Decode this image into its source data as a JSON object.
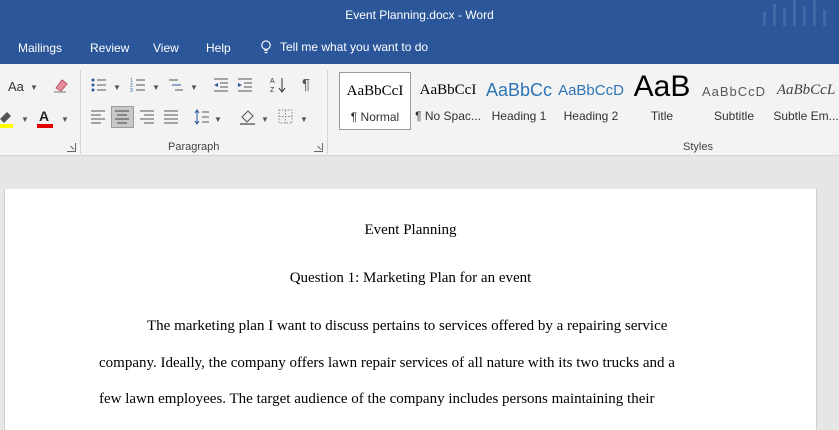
{
  "window": {
    "title": "Event Planning.docx  -  Word"
  },
  "menu": {
    "tabs": [
      "Mailings",
      "Review",
      "View",
      "Help"
    ],
    "tell_me": "Tell me what you want to do"
  },
  "ribbon": {
    "font_group": {
      "change_case_label": "Aa",
      "font_color_letter": "A",
      "highlight_color": "#ffff00",
      "font_color": "#e00000"
    },
    "paragraph_group": {
      "label": "Paragraph",
      "show_marks_glyph": "¶"
    },
    "styles_group": {
      "label": "Styles",
      "items": [
        {
          "sample": "AaBbCcI",
          "name": "¶ Normal",
          "selected": true
        },
        {
          "sample": "AaBbCcI",
          "name": "¶ No Spac..."
        },
        {
          "sample": "AaBbCc",
          "name": "Heading 1",
          "color": "#2e74b5"
        },
        {
          "sample": "AaBbCcD",
          "name": "Heading 2",
          "color": "#2e74b5"
        },
        {
          "sample": "AaB",
          "name": "Title"
        },
        {
          "sample": "AaBbCcD",
          "name": "Subtitle",
          "color": "#595959"
        },
        {
          "sample": "AaBbCcL",
          "name": "Subtle Em...",
          "color": "#404040"
        }
      ]
    }
  },
  "document": {
    "lines": [
      "Event Planning",
      "Question 1: Marketing Plan for an event",
      "The marketing plan I want to discuss pertains to services offered by a repairing service",
      "company. Ideally, the company offers lawn repair services of all nature with its two trucks and a",
      "few lawn employees. The target audience of the company includes persons maintaining their"
    ]
  }
}
